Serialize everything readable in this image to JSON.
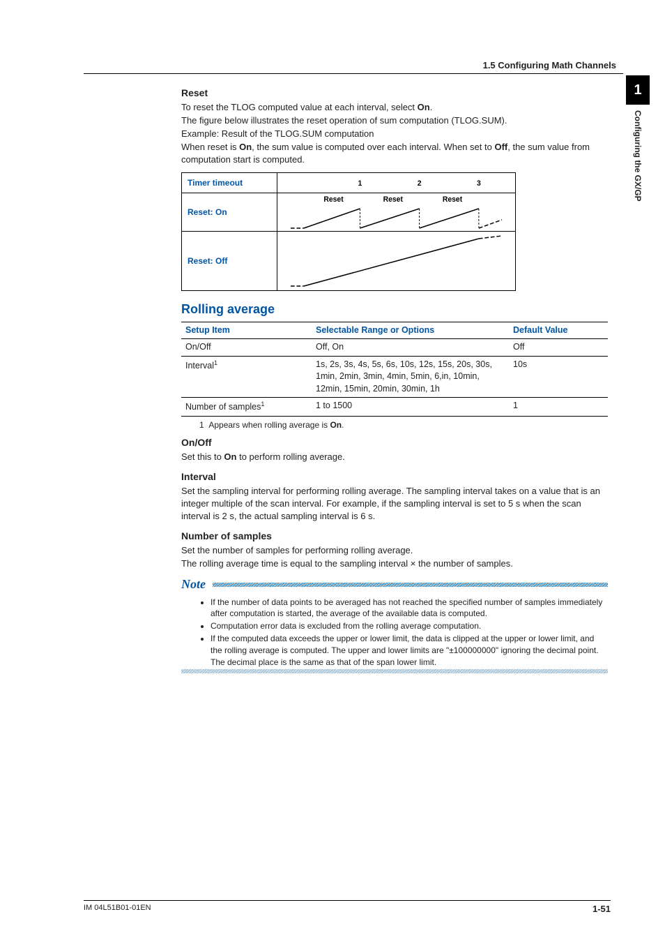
{
  "running_header": "1.5  Configuring Math Channels",
  "side_tab": {
    "num": "1",
    "label": "Configuring the GX/GP"
  },
  "reset": {
    "title": "Reset",
    "p1a": "To reset the TLOG computed value at each interval, select ",
    "p1b": "On",
    "p1c": ".",
    "p2": "The figure below illustrates the reset operation of sum computation (TLOG.SUM).",
    "p3": "Example: Result of the TLOG.SUM computation",
    "p4a": "When reset is ",
    "p4b": "On",
    "p4c": ", the sum value is computed over each interval. When set to ",
    "p4d": "Off",
    "p4e": ", the sum value from computation start is computed."
  },
  "diagram": {
    "row1": "Timer timeout",
    "row2": "Reset: On",
    "row3": "Reset: Off",
    "n1": "1",
    "n2": "2",
    "n3": "3",
    "reset_label": "Reset"
  },
  "section_title": "Rolling average",
  "table": {
    "h1": "Setup Item",
    "h2": "Selectable Range or Options",
    "h3": "Default Value",
    "r1": {
      "item": "On/Off",
      "opts": "Off, On",
      "def": "Off"
    },
    "r2": {
      "item": "Interval",
      "sup": "1",
      "opts": "1s, 2s, 3s, 4s, 5s, 6s, 10s, 12s, 15s, 20s, 30s, 1min, 2min, 3min, 4min, 5min, 6,in, 10min, 12min, 15min, 20min, 30min, 1h",
      "def": "10s"
    },
    "r3": {
      "item": "Number of samples",
      "sup": "1",
      "opts": "1 to 1500",
      "def": "1"
    }
  },
  "footnote": {
    "num": "1",
    "text_a": "Appears when rolling average is ",
    "bold": "On",
    "text_b": "."
  },
  "onoff": {
    "title": "On/Off",
    "p_a": "Set this to ",
    "bold": "On",
    "p_b": " to perform rolling average."
  },
  "interval": {
    "title": "Interval",
    "p": "Set the sampling interval for performing rolling average. The sampling interval takes on a value that is an integer multiple of the scan interval. For example, if the sampling interval is set to 5 s when the scan interval is 2 s, the actual sampling interval is 6 s."
  },
  "nsamples": {
    "title": "Number of samples",
    "p1": "Set the number of samples for performing rolling average.",
    "p2": "The rolling average time is equal to the sampling interval × the number of samples."
  },
  "note": {
    "title": "Note",
    "items": [
      "If the number of data points to be averaged has not reached the specified number of samples immediately after computation is started, the average of the available data is computed.",
      "Computation error data is excluded from the rolling average computation.",
      "If the computed data exceeds the upper or lower limit, the data is clipped at the upper or lower limit, and the rolling average is computed. The upper and lower limits are \"±100000000\" ignoring the decimal point. The decimal place is the same as that of the span lower limit."
    ]
  },
  "footer": {
    "left": "IM 04L51B01-01EN",
    "right": "1-51"
  }
}
